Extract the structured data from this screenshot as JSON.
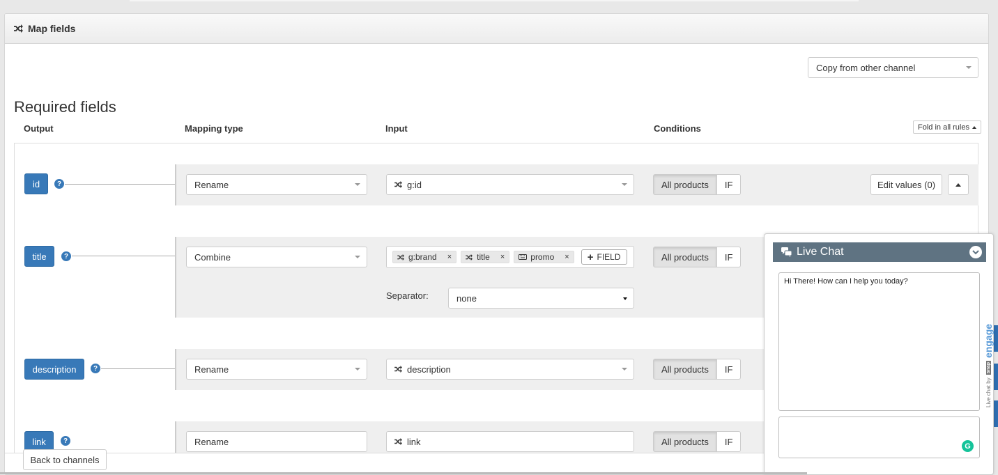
{
  "panel": {
    "title": "Map fields"
  },
  "copy_select": {
    "value": "Copy from other channel"
  },
  "section": {
    "title": "Required fields"
  },
  "columns": {
    "output": "Output",
    "mapping_type": "Mapping type",
    "input": "Input",
    "conditions": "Conditions"
  },
  "fold_button": "Fold in all rules",
  "rows": {
    "id": {
      "label": "id",
      "mapping": "Rename",
      "input": "g:id",
      "cond_all": "All products",
      "cond_if": "IF",
      "edit_values": "Edit values (0)"
    },
    "title": {
      "label": "title",
      "mapping": "Combine",
      "tokens": [
        {
          "label": "g:brand",
          "icon": "shuffle-icon"
        },
        {
          "label": "title",
          "icon": "shuffle-icon"
        },
        {
          "label": "promo",
          "icon": "keyboard-icon"
        }
      ],
      "field_button": "FIELD",
      "separator_label": "Separator:",
      "separator_value": "none",
      "cond_all": "All products",
      "cond_if": "IF"
    },
    "description": {
      "label": "description",
      "mapping": "Rename",
      "input": "description",
      "cond_all": "All products",
      "cond_if": "IF"
    },
    "link": {
      "label": "link",
      "mapping": "Rename",
      "input": "link",
      "cond_all": "All products",
      "cond_if": "IF"
    }
  },
  "footer": {
    "back_button": "Back to channels"
  },
  "chat": {
    "title": "Live Chat",
    "greeting": "Hi There! How can I help you today?",
    "brand_prefix": "Live chat by",
    "brand_box": "snap",
    "brand_name": "engage"
  },
  "colors": {
    "primary": "#3879b8",
    "chat_header": "#5f7382",
    "grammarly": "#15c39a"
  }
}
